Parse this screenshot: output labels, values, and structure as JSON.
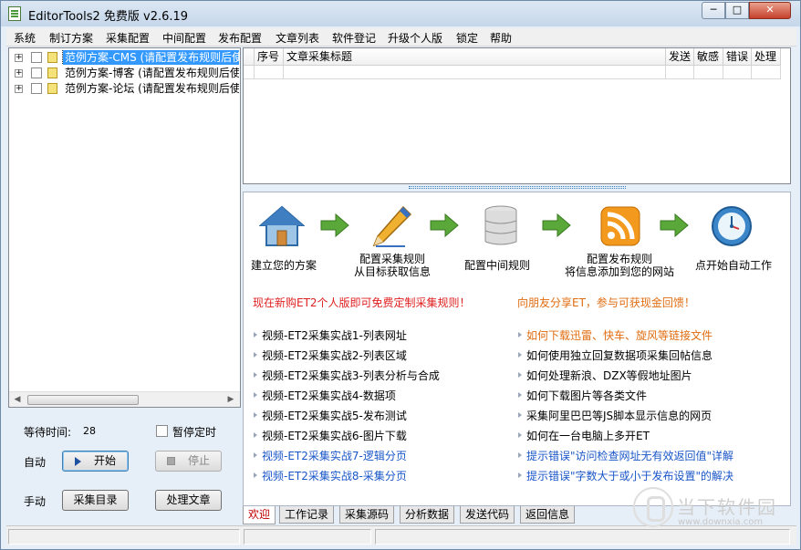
{
  "window": {
    "title": "EditorTools2 免费版 v2.6.19",
    "min_label": "─",
    "max_label": "□",
    "close_label": "✕"
  },
  "menu": [
    "系统",
    "制订方案",
    "采集配置",
    "中间配置",
    "发布配置",
    "文章列表",
    "软件登记",
    "升级个人版",
    "锁定",
    "帮助"
  ],
  "tree": {
    "items": [
      {
        "label": "范例方案-CMS (请配置发布规则后使",
        "selected": true
      },
      {
        "label": "范例方案-博客 (请配置发布规则后使",
        "selected": false
      },
      {
        "label": "范例方案-论坛 (请配置发布规则后使",
        "selected": false
      }
    ],
    "scroll_left": "◀",
    "scroll_right": "▶"
  },
  "controls": {
    "wait_label": "等待时间:",
    "wait_value": "28",
    "pause_label": "暂停定时",
    "auto_label": "自动",
    "start_label": "开始",
    "stop_label": "停止",
    "manual_label": "手动",
    "collect_dir_label": "采集目录",
    "process_label": "处理文章"
  },
  "grid": {
    "columns": [
      "序号",
      "文章采集标题",
      "发送",
      "敏感",
      "错误",
      "处理"
    ]
  },
  "workflow": {
    "steps": [
      {
        "icon": "home-icon",
        "lines": [
          "建立您的方案"
        ]
      },
      {
        "icon": "pencil-icon",
        "lines": [
          "配置采集规则",
          "从目标获取信息"
        ]
      },
      {
        "icon": "database-icon",
        "lines": [
          "配置中间规则"
        ]
      },
      {
        "icon": "rss-icon",
        "lines": [
          "配置发布规则",
          "将信息添加到您的网站"
        ]
      },
      {
        "icon": "clock-icon",
        "lines": [
          "点开始自动工作"
        ]
      }
    ]
  },
  "promos": {
    "left": "现在新购ET2个人版即可免费定制采集规则！",
    "right": "向朋友分享ET，参与可获现金回馈！"
  },
  "links_left": [
    {
      "text": "视频-ET2采集实战1-列表网址",
      "color": "#000000"
    },
    {
      "text": "视频-ET2采集实战2-列表区域",
      "color": "#000000"
    },
    {
      "text": "视频-ET2采集实战3-列表分析与合成",
      "color": "#000000"
    },
    {
      "text": "视频-ET2采集实战4-数据项",
      "color": "#000000"
    },
    {
      "text": "视频-ET2采集实战5-发布测试",
      "color": "#000000"
    },
    {
      "text": "视频-ET2采集实战6-图片下载",
      "color": "#000000"
    },
    {
      "text": "视频-ET2采集实战7-逻辑分页",
      "color": "#1a56c8"
    },
    {
      "text": "视频-ET2采集实战8-采集分页",
      "color": "#1a56c8"
    }
  ],
  "links_right": [
    {
      "text": "如何下载迅雷、快车、旋风等链接文件",
      "color": "#e06c10"
    },
    {
      "text": "如何使用独立回复数据项采集回帖信息",
      "color": "#000000"
    },
    {
      "text": "如何处理新浪、DZX等假地址图片",
      "color": "#000000"
    },
    {
      "text": "如何下载图片等各类文件",
      "color": "#000000"
    },
    {
      "text": "采集阿里巴巴等JS脚本显示信息的网页",
      "color": "#000000"
    },
    {
      "text": "如何在一台电脑上多开ET",
      "color": "#000000"
    },
    {
      "text": "提示错误\"访问检查网址无有效返回值\"详解",
      "color": "#1a56c8"
    },
    {
      "text": "提示错误\"字数大于或小于发布设置\"的解决",
      "color": "#1a56c8"
    }
  ],
  "tabs": [
    "欢迎",
    "工作记录",
    "采集源码",
    "分析数据",
    "发送代码",
    "返回信息"
  ],
  "watermark": {
    "brand": "当下软件园",
    "url": "www.downxia.com"
  },
  "colors": {
    "promo_left": "#e02020",
    "promo_right": "#e06c10",
    "accent": "#3399ff"
  }
}
